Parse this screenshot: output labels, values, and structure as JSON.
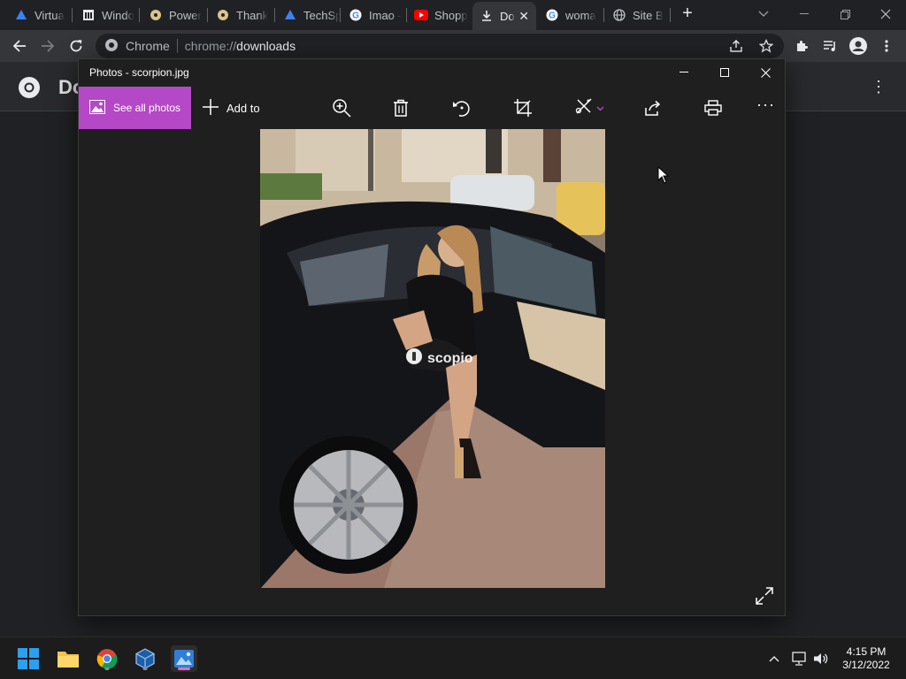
{
  "browser": {
    "tabs": [
      {
        "label": "Virtua",
        "icon": "virtualbox-icon"
      },
      {
        "label": "Windo",
        "icon": "museum-icon"
      },
      {
        "label": "Power",
        "icon": "cd-icon"
      },
      {
        "label": "Thank",
        "icon": "cd-icon"
      },
      {
        "label": "TechSp",
        "icon": "virtualbox-icon"
      },
      {
        "label": "Imao -",
        "icon": "google-icon"
      },
      {
        "label": "Shopp",
        "icon": "youtube-icon"
      },
      {
        "label": "Do",
        "icon": "download-icon",
        "active": true
      },
      {
        "label": "woma",
        "icon": "google-icon"
      },
      {
        "label": "Site B",
        "icon": "globe-icon"
      }
    ],
    "address": {
      "site": "Chrome",
      "scheme": "chrome://",
      "host": "downloads"
    }
  },
  "page": {
    "title": "Do"
  },
  "photos": {
    "title": "Photos - scorpion.jpg",
    "see_all_label": "See all photos",
    "add_to_label": "Add to",
    "watermark": "scopio"
  },
  "taskbar": {
    "time": "4:15 PM",
    "date": "3/12/2022"
  },
  "colors": {
    "accent": "#b548c6",
    "chrome_bg": "#202124",
    "toolbar_bg": "#35363a"
  }
}
